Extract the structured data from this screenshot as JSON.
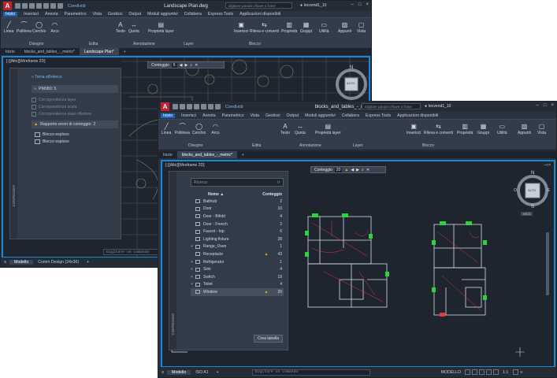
{
  "back": {
    "title": "Landscape Plan.dwg",
    "share": "Condividi",
    "search_placeholder": "Digitare parola chiave o frase",
    "user": "lecvend1_10",
    "menu": [
      "Inizio",
      "Inserisci",
      "Annota",
      "Parametrico",
      "Vista",
      "Gestisci",
      "Output",
      "Moduli aggiuntivi",
      "Collabora",
      "Express Tools",
      "Applicazioni disponibili"
    ],
    "ribbon_tools": [
      "Linea",
      "Polilinea",
      "Cerchio",
      "Arco",
      "Testo",
      "Quota",
      "Proprietà layer",
      "Inserisci",
      "Rileva e converti",
      "Proprietà",
      "Gruppi",
      "Utilità",
      "Appunti",
      "Vista"
    ],
    "panels": [
      "Disegno",
      "Edita",
      "Annotazione",
      "Layer",
      "Blocco"
    ],
    "doc_tabs": [
      "Inizio",
      "blocks_and_tables_-_metric*",
      "Landscape Plan*"
    ],
    "view_label": "[-][Alto][Wireframe 2D]",
    "count_label": "Conteggio",
    "count_value": "5",
    "compass": {
      "n": "N",
      "s": "S",
      "e": "E",
      "w": "O",
      "center": "ALTO"
    },
    "panel": {
      "back_link": "« Torna all'elenco",
      "item": "PM080: 5",
      "options": [
        "Corrispondenza layer",
        "Corrispondenza scala",
        "Corrispondenza stato riflettore"
      ],
      "report": "Rapporto errori di conteggio: 2",
      "errors": [
        "Blocco esploso",
        "Blocco esploso"
      ],
      "side_label": "CONTEGGIO"
    },
    "status_tabs": [
      "Modello",
      "Comm Design (24x36)"
    ],
    "cmd_placeholder": "Digitare un comando"
  },
  "front": {
    "title": "blocks_and_tables_-_metric.dwg",
    "share": "Condividi",
    "search_placeholder": "Digitare parola chiave o frase",
    "user": "lecvend1_10",
    "menu": [
      "Inizio",
      "Inserisci",
      "Annota",
      "Parametrico",
      "Vista",
      "Gestisci",
      "Output",
      "Moduli aggiuntivi",
      "Collabora",
      "Express Tools",
      "Applicazioni disponibili"
    ],
    "ribbon_tools": [
      "Linea",
      "Polilinea",
      "Cerchio",
      "Arco",
      "Testo",
      "Quota",
      "Proprietà layer",
      "Inserisci",
      "Rileva e converti",
      "Proprietà",
      "Gruppi",
      "Utilità",
      "Appunti",
      "Vista"
    ],
    "panels": [
      "Disegno",
      "Edita",
      "Annotazione",
      "Layer",
      "Blocco"
    ],
    "doc_tabs": [
      "Inizio",
      "blocks_and_tables_-_metric*"
    ],
    "view_label": "[-][Alto][Wireframe 2D]",
    "count_label": "Conteggio",
    "count_value": "20",
    "compass": {
      "n": "N",
      "s": "S",
      "e": "E",
      "w": "O",
      "center": "ALTO"
    },
    "wcs": "WCS",
    "panel": {
      "search_placeholder": "Ricerca",
      "col_name": "Nome ▲",
      "col_count": "Conteggio",
      "rows": [
        {
          "name": "Bathtub",
          "count": "2",
          "expand": false,
          "warn": false
        },
        {
          "name": "Door",
          "count": "10",
          "expand": false,
          "warn": false
        },
        {
          "name": "Door - Bifold",
          "count": "4",
          "expand": false,
          "warn": false
        },
        {
          "name": "Door - French",
          "count": "2",
          "expand": false,
          "warn": false
        },
        {
          "name": "Faucet - top",
          "count": "6",
          "expand": false,
          "warn": false
        },
        {
          "name": "Lighting fixture",
          "count": "28",
          "expand": false,
          "warn": false
        },
        {
          "name": "Range_Oven",
          "count": "1",
          "expand": true,
          "warn": false
        },
        {
          "name": "Receptacle",
          "count": "43",
          "expand": false,
          "warn": true
        },
        {
          "name": "Refrigerator",
          "count": "1",
          "expand": true,
          "warn": false
        },
        {
          "name": "Sink",
          "count": "4",
          "expand": true,
          "warn": false
        },
        {
          "name": "Switch",
          "count": "19",
          "expand": true,
          "warn": false
        },
        {
          "name": "Toilet",
          "count": "4",
          "expand": true,
          "warn": false
        },
        {
          "name": "Window",
          "count": "20",
          "expand": false,
          "warn": true,
          "selected": true
        }
      ],
      "create_table": "Crea tabella",
      "side_label": "CONTEGGIO"
    },
    "status_tabs": [
      "Modello",
      "ISO A1"
    ],
    "cmd_placeholder": "Digitare un comando",
    "status_right": "MODELLO",
    "scale": "1:1"
  },
  "colors": {
    "accent": "#1a86d6",
    "warning": "#f2b01e",
    "ok": "#3fb34f",
    "drawing_bg": "#1f252e"
  }
}
